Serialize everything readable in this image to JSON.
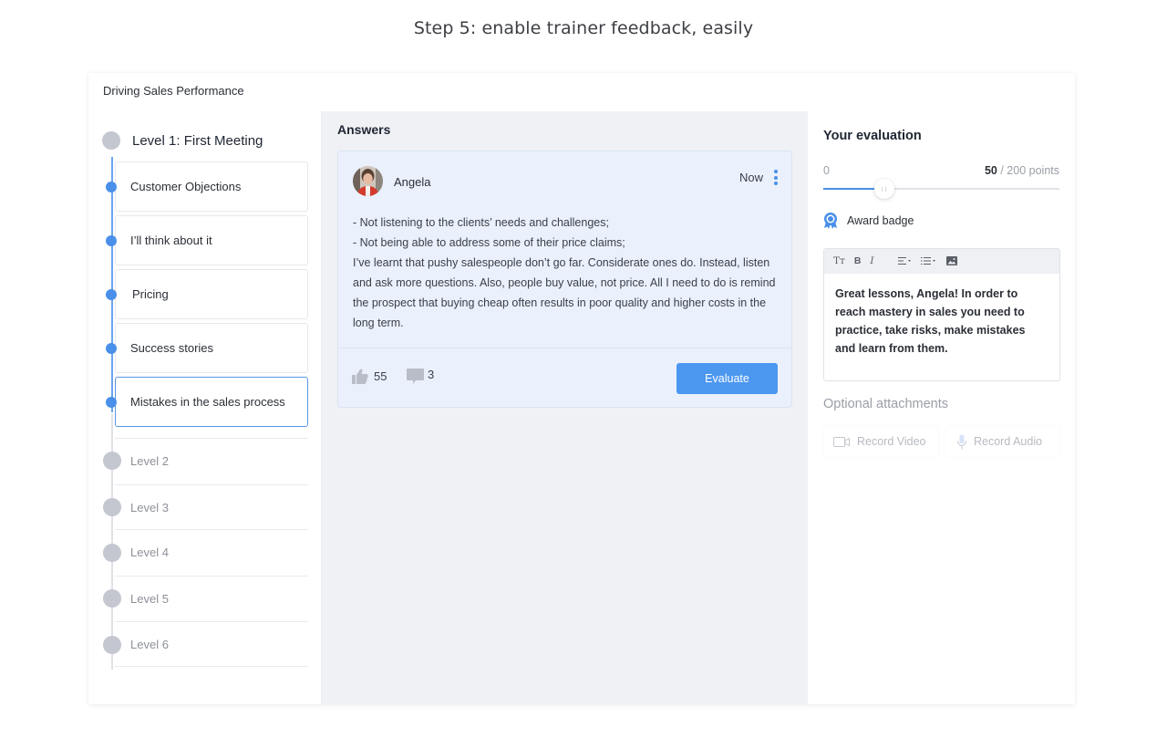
{
  "page": {
    "step_title": "Step 5: enable trainer feedback, easily"
  },
  "app": {
    "title": "Driving Sales Performance"
  },
  "sidebar": {
    "level1_title": "Level 1: First Meeting",
    "lessons": [
      {
        "label": "Customer Objections",
        "selected": false
      },
      {
        "label": "I’ll think about it",
        "selected": false
      },
      {
        "label": "Pricing",
        "selected": false
      },
      {
        "label": "Success stories",
        "selected": false
      },
      {
        "label": "Mistakes in the sales process",
        "selected": true
      }
    ],
    "levels": [
      {
        "label": "Level 2"
      },
      {
        "label": "Level 3"
      },
      {
        "label": "Level 4"
      },
      {
        "label": "Level 5"
      },
      {
        "label": "Level 6"
      }
    ]
  },
  "answers": {
    "title": "Answers",
    "card": {
      "author": "Angela",
      "time": "Now",
      "body": [
        "- Not listening to the clients’ needs and challenges;",
        "- Not being able to address some of their price claims;",
        "I’ve learnt that pushy salespeople don’t go far. Considerate ones do. Instead, listen and ask more questions. Also, people buy value, not price. All I need to do is remind the prospect that buying cheap often results in poor quality and higher costs in the long term."
      ],
      "likes": "55",
      "comments": "3",
      "evaluate_label": "Evaluate"
    }
  },
  "evaluation": {
    "title": "Your evaluation",
    "slider": {
      "min_label": "0",
      "value": "50",
      "max_suffix": " / 200 points",
      "fraction": 0.25
    },
    "award_label": "Award badge",
    "toolbar": {
      "text_size": "Tт",
      "bold": "B",
      "italic": "I"
    },
    "feedback_text": "Great lessons, Angela! In order to reach mastery in sales you need to practice, take risks, make mistakes and learn from them.",
    "attachments_title": "Optional attachments",
    "record_video_label": "Record Video",
    "record_audio_label": "Record Audio"
  },
  "colors": {
    "accent": "#4a8fea",
    "button": "#4c97f0",
    "card_bg": "#eaf1fc",
    "pane_bg": "#eff1f5"
  }
}
